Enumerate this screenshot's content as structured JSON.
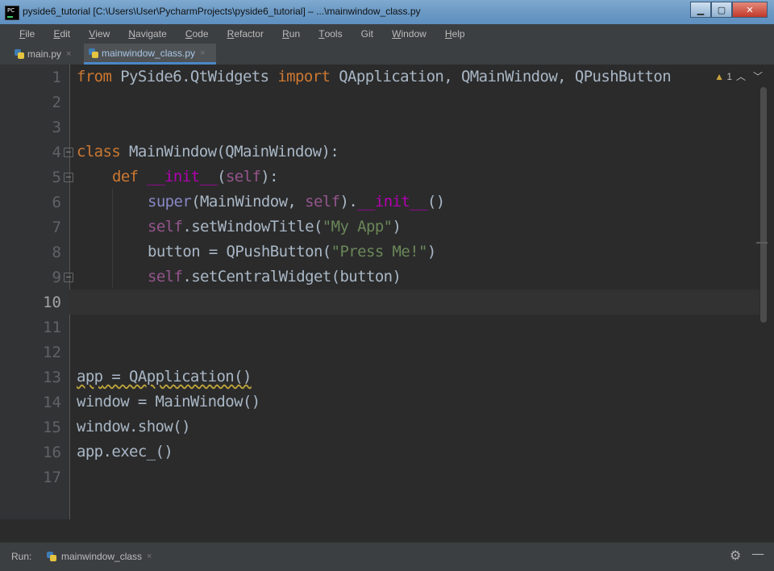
{
  "window": {
    "title": "pyside6_tutorial [C:\\Users\\User\\PycharmProjects\\pyside6_tutorial] – ...\\mainwindow_class.py",
    "icon_label": "PC"
  },
  "menu": [
    {
      "u": "F",
      "rest": "ile"
    },
    {
      "u": "E",
      "rest": "dit"
    },
    {
      "u": "V",
      "rest": "iew"
    },
    {
      "u": "N",
      "rest": "avigate"
    },
    {
      "u": "C",
      "rest": "ode"
    },
    {
      "u": "R",
      "rest": "efactor"
    },
    {
      "u": "R",
      "rest": "un"
    },
    {
      "u": "T",
      "rest": "ools"
    },
    {
      "u": "",
      "rest": "Git"
    },
    {
      "u": "W",
      "rest": "indow"
    },
    {
      "u": "H",
      "rest": "elp"
    }
  ],
  "tabs": [
    {
      "label": "main.py",
      "close": "×"
    },
    {
      "label": "mainwindow_class.py",
      "close": "×"
    }
  ],
  "editor": {
    "line_numbers": [
      "1",
      "2",
      "3",
      "4",
      "5",
      "6",
      "7",
      "8",
      "9",
      "10",
      "11",
      "12",
      "13",
      "14",
      "15",
      "16",
      "17"
    ],
    "warnings_count": "1",
    "code": {
      "l1": {
        "t1": "from",
        "t2": " PySide6.QtWidgets ",
        "t3": "import",
        "t4": " QApplication, QMainWindow, QPushButton"
      },
      "l4": {
        "t1": "class",
        "t2": " MainWindow(QMainWindow):"
      },
      "l5": {
        "t1": "def",
        "t2": " ",
        "t3": "__init__",
        "t4": "(",
        "t5": "self",
        "t6": "):"
      },
      "l6": {
        "t1": "super",
        "t2": "(MainWindow, ",
        "t3": "self",
        "t4": ").",
        "t5": "__init__",
        "t6": "()"
      },
      "l7": {
        "t1": "self",
        "t2": ".setWindowTitle(",
        "t3": "\"My App\"",
        "t4": ")"
      },
      "l8": {
        "t1": "button = QPushButton(",
        "t2": "\"Press Me!\"",
        "t3": ")"
      },
      "l9": {
        "t1": "self",
        "t2": ".setCentralWidget(button)"
      },
      "l13": {
        "t1": "app",
        "t2": " = QApplication()"
      },
      "l14": "window = MainWindow()",
      "l15": "window.show()",
      "l16": "app.exec_()"
    }
  },
  "run": {
    "label": "Run:",
    "tab": "mainwindow_class",
    "close": "×"
  }
}
